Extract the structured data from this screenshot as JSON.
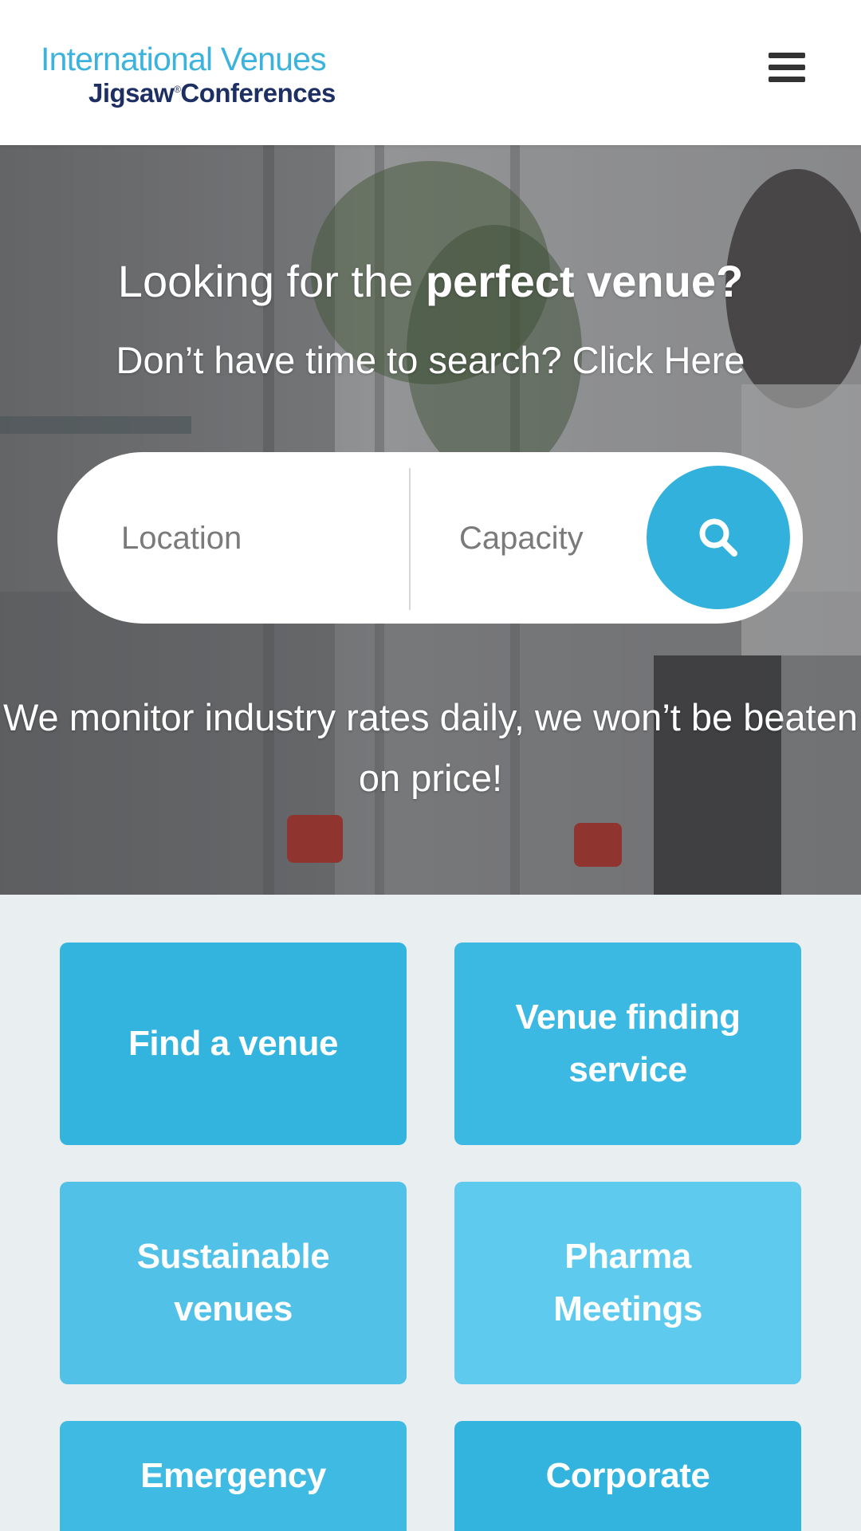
{
  "header": {
    "logo_line1": "International Venues",
    "logo_line2": "Jigsaw",
    "logo_reg": "®",
    "logo_line2b": "Conferences",
    "menu_icon": "hamburger-menu-icon"
  },
  "hero": {
    "title_light": "Looking for the ",
    "title_bold": "perfect venue?",
    "subtitle": "Don’t have time to search? Click Here",
    "search": {
      "location_placeholder": "Location",
      "capacity_placeholder": "Capacity",
      "search_icon": "search-icon"
    },
    "note_line1": "We monitor industry rates daily, we won’t be beaten",
    "note_line2": "on price!"
  },
  "tiles": [
    {
      "label_1": "Find a venue",
      "label_2": "",
      "color": "#33b4de"
    },
    {
      "label_1": "Venue finding",
      "label_2": "service",
      "color": "#3cb9e2"
    },
    {
      "label_1": "Sustainable",
      "label_2": "venues",
      "color": "#52c1e7"
    },
    {
      "label_1": "Pharma",
      "label_2": "Meetings",
      "color": "#5ecaee"
    },
    {
      "label_1": "Emergency",
      "label_2": "",
      "color": "#3fbae3"
    },
    {
      "label_1": "Corporate",
      "label_2": "",
      "color": "#33b4de"
    }
  ],
  "colors": {
    "accent": "#31b1dc",
    "brand_navy": "#1d2f63",
    "page_bg": "#e9eef1"
  }
}
